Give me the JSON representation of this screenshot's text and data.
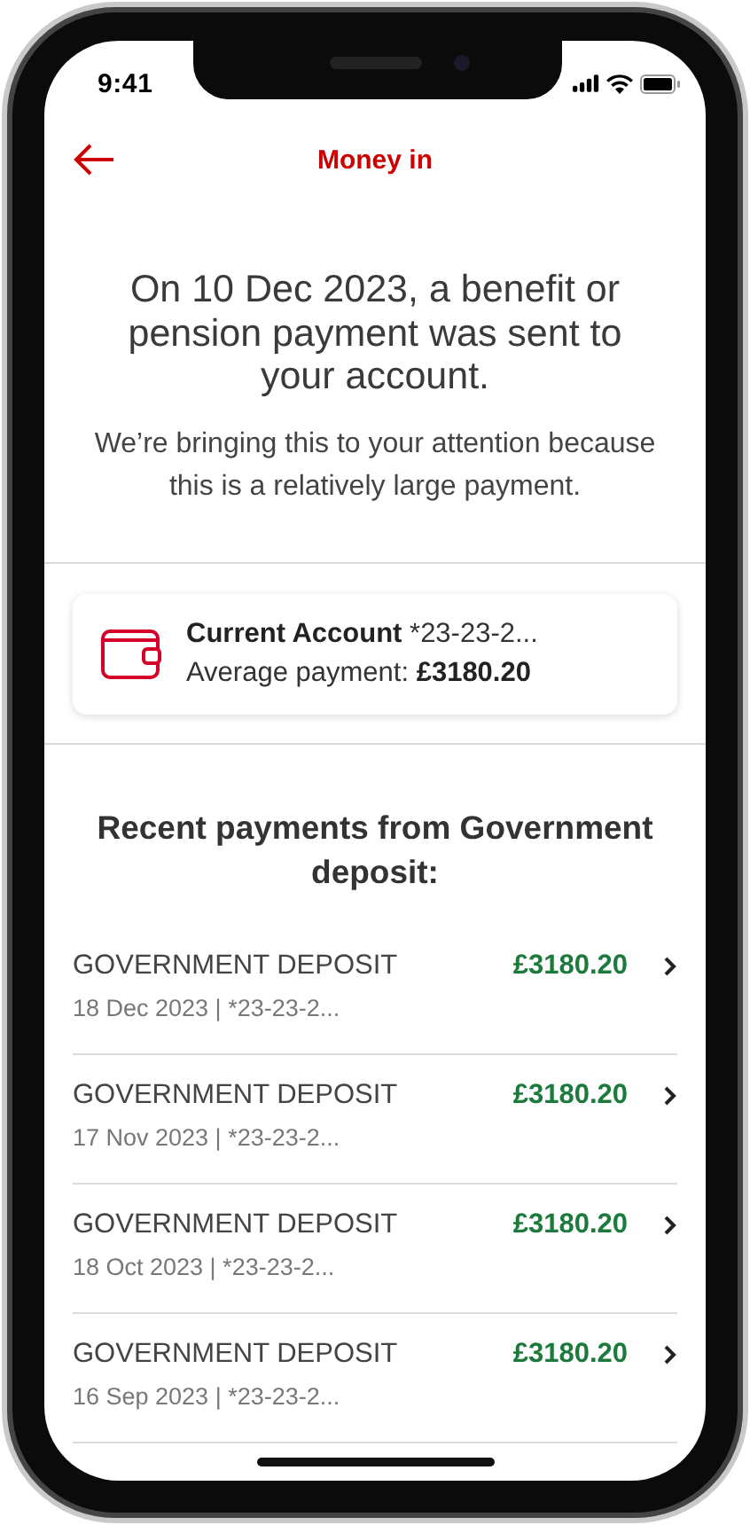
{
  "status_bar": {
    "time": "9:41"
  },
  "header": {
    "title": "Money in"
  },
  "alert": {
    "headline": "On 10 Dec 2023, a benefit or pension payment was sent to your account.",
    "body": "We’re bringing this to your attention because this is a relatively large payment."
  },
  "account_card": {
    "name": "Current Account",
    "number": "*23-23-2...",
    "average": "Average payment: **£3180.20**"
  },
  "recent": {
    "title": "Recent payments from Government deposit:",
    "payments": [
      {
        "payee": "GOVERNMENT DEPOSIT",
        "amount": "£3180.20",
        "details": "18 Dec 2023 | *23-23-2..."
      },
      {
        "payee": "GOVERNMENT DEPOSIT",
        "amount": "£3180.20",
        "details": "17 Nov 2023 | *23-23-2..."
      },
      {
        "payee": "GOVERNMENT DEPOSIT",
        "amount": "£3180.20",
        "details": "18 Oct 2023 | *23-23-2..."
      },
      {
        "payee": "GOVERNMENT DEPOSIT",
        "amount": "£3180.20",
        "details": "16 Sep 2023 | *23-23-2..."
      }
    ]
  }
}
